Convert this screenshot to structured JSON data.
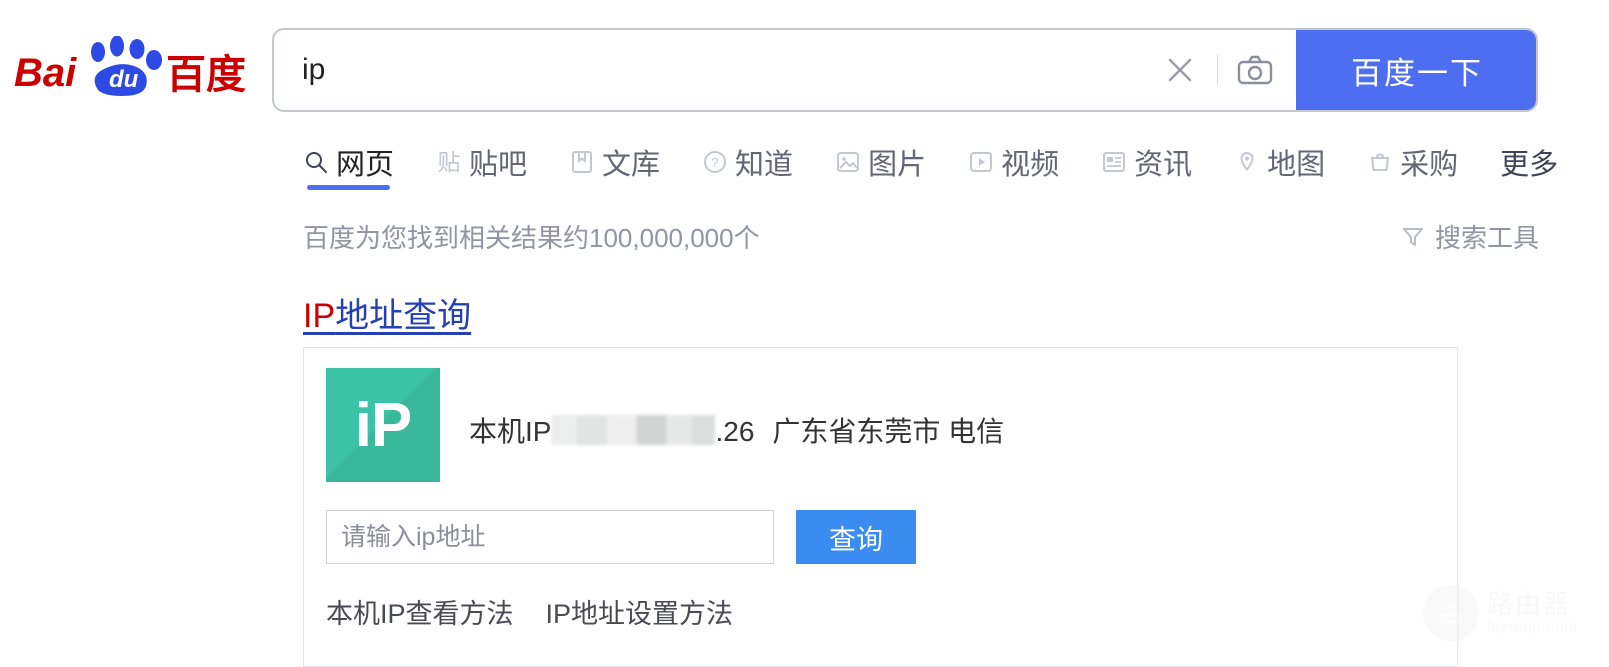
{
  "brand": {
    "logo_text_latin": "Baidu",
    "logo_text_cn": "百度",
    "logo_paw_label": "du",
    "accent_blue": "#4e6ef2",
    "accent_red": "#cc0000"
  },
  "search": {
    "value": "ip",
    "placeholder": "",
    "clear_icon": "close-icon",
    "camera_icon": "camera-icon",
    "submit_label": "百度一下"
  },
  "nav": {
    "items": [
      {
        "label": "网页",
        "icon": "search-icon",
        "active": true
      },
      {
        "label": "贴吧",
        "icon": "tieba-icon",
        "active": false
      },
      {
        "label": "文库",
        "icon": "book-icon",
        "active": false
      },
      {
        "label": "知道",
        "icon": "question-icon",
        "active": false
      },
      {
        "label": "图片",
        "icon": "image-icon",
        "active": false
      },
      {
        "label": "视频",
        "icon": "video-icon",
        "active": false
      },
      {
        "label": "资讯",
        "icon": "news-icon",
        "active": false
      },
      {
        "label": "地图",
        "icon": "map-pin-icon",
        "active": false
      },
      {
        "label": "采购",
        "icon": "cart-icon",
        "active": false
      },
      {
        "label": "更多",
        "icon": "",
        "active": false
      }
    ]
  },
  "results_meta": {
    "count_text": "百度为您找到相关结果约100,000,000个",
    "tools_label": "搜索工具",
    "tools_icon": "filter-icon"
  },
  "result": {
    "title_highlight": "IP",
    "title_rest": "地址查询",
    "card": {
      "logo_text": "iP",
      "logo_color": "#3cc3a5",
      "ip_prefix": "本机IP",
      "ip_masked": true,
      "ip_suffix": ".26",
      "ip_location": "广东省东莞市 电信",
      "input_placeholder": "请输入ip地址",
      "input_value": "",
      "query_button": "查询",
      "links": [
        "本机IP查看方法",
        "IP地址设置方法"
      ]
    }
  },
  "watermark": {
    "title": "路由器",
    "domain": "luyouqi.com",
    "icon": "router-icon"
  }
}
